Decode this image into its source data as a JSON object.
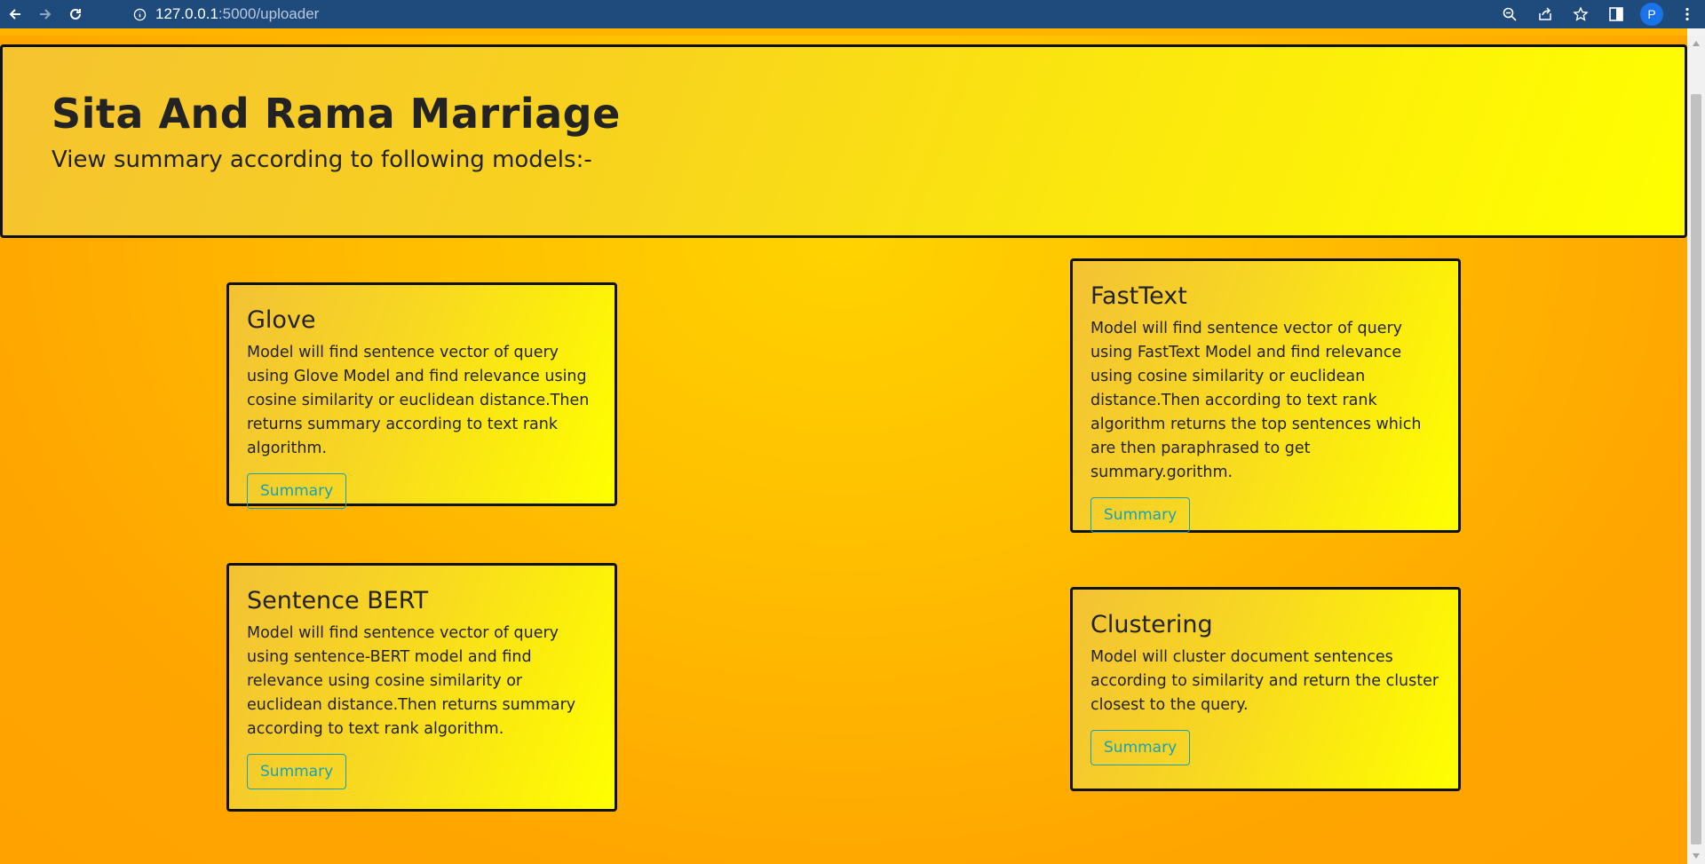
{
  "browser": {
    "url_host": "127.0.0.1",
    "url_rest": ":5000/uploader",
    "profile_initial": "P",
    "icons": [
      "back-icon",
      "forward-icon",
      "reload-icon",
      "info-icon",
      "zoom-icon",
      "share-icon",
      "star-icon",
      "sidepanel-icon",
      "menu-icon"
    ]
  },
  "hero": {
    "title": "Sita And Rama Marriage",
    "subtitle": "View summary according to following models:-"
  },
  "cards": [
    {
      "title": "Glove",
      "text": "Model will find sentence vector of query using Glove Model and find relevance using cosine similarity or euclidean distance.Then returns summary according to text rank algorithm.",
      "button": "Summary"
    },
    {
      "title": "FastText",
      "text": "Model will find sentence vector of query using FastText Model and find relevance using cosine similarity or euclidean distance.Then according to text rank algorithm returns the top sentences which are then paraphrased to get summary.gorithm.",
      "button": "Summary"
    },
    {
      "title": "Sentence BERT",
      "text": "Model will find sentence vector of query using sentence-BERT model and find relevance using cosine similarity or euclidean distance.Then returns summary according to text rank algorithm.",
      "button": "Summary"
    },
    {
      "title": "Clustering",
      "text": "Model will cluster document sentences according to similarity and return the cluster closest to the query.",
      "button": "Summary"
    }
  ],
  "colors": {
    "chrome": "#1e4a7c",
    "page_bg": "#ffa500",
    "card_gradient_end": "#ffff00",
    "button_accent": "#17a2b8",
    "text": "#232323"
  }
}
